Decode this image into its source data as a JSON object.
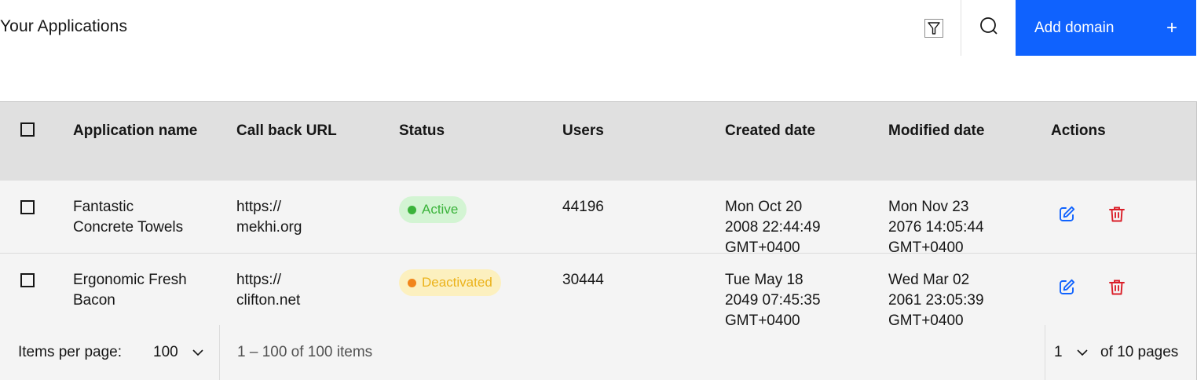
{
  "header": {
    "title": "Your Applications",
    "filter_icon": "filter-icon",
    "search_icon": "search-icon",
    "add_label": "Add domain",
    "add_icon": "+"
  },
  "table": {
    "columns": [
      "Application name",
      "Call back URL",
      "Status",
      "Users",
      "Created date",
      "Modified date",
      "Actions"
    ],
    "rows": [
      {
        "name": [
          "Fantastic",
          "Concrete Towels"
        ],
        "url": [
          "https://",
          "mekhi.org"
        ],
        "status": "Active",
        "users": "44196",
        "created": [
          "Mon Oct 20",
          "2008 22:44:49",
          "GMT+0400"
        ],
        "modified": [
          "Mon Nov 23",
          "2076 14:05:44",
          "GMT+0400"
        ]
      },
      {
        "name": [
          "Ergonomic Fresh",
          "Bacon"
        ],
        "url": [
          "https://",
          "clifton.net"
        ],
        "status": "Deactivated",
        "users": "30444",
        "created": [
          "Tue May 18",
          "2049 07:45:35",
          "GMT+0400"
        ],
        "modified": [
          "Wed Mar 02",
          "2061 23:05:39",
          "GMT+0400"
        ]
      }
    ]
  },
  "pagination": {
    "items_per_page_label": "Items per page:",
    "items_per_page_value": "100",
    "range_text": "1 – 100 of 100 items",
    "page_value": "1",
    "pages_text": "of 10 pages"
  },
  "colors": {
    "accent": "#0f62fe",
    "active": "#3bb33b",
    "deactivated": "#ebb21b",
    "edit_icon": "#0f62fe",
    "delete_icon": "#da1e28"
  }
}
